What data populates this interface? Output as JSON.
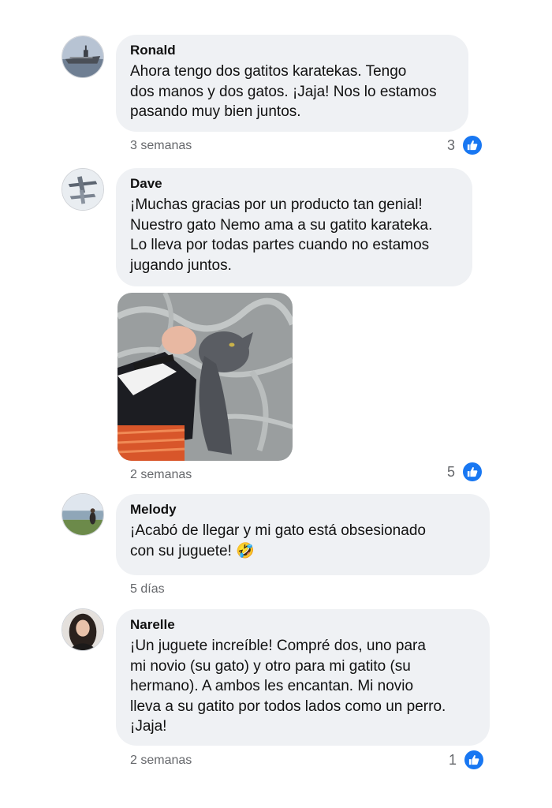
{
  "comments": [
    {
      "author": "Ronald",
      "avatar_icon": "aircraft-carrier-avatar",
      "text": "Ahora tengo dos gatitos karatekas. Tengo\ndos manos y dos gatos. ¡Jaja! Nos lo estamos\npasando muy bien juntos.",
      "time": "3 semanas",
      "likes": "3"
    },
    {
      "author": "Dave",
      "avatar_icon": "airplane-avatar",
      "text": "¡Muchas gracias por un producto tan genial!\nNuestro gato Nemo ama a su gatito karateka.\nLo lleva por todas partes cuando no estamos\njugando juntos.",
      "time": "2 semanas",
      "likes": "5",
      "photo_icon": "cat-with-karate-toy-photo"
    },
    {
      "author": "Melody",
      "avatar_icon": "lakeside-person-avatar",
      "text": "¡Acabó de llegar y mi gato está obsesionado\ncon su juguete! 🤣",
      "time": "5 días"
    },
    {
      "author": "Narelle",
      "avatar_icon": "woman-portrait-avatar",
      "text": "¡Un juguete increíble! Compré dos, uno para\nmi novio (su gato) y otro para mi gatito (su\nhermano). A ambos les encantan. Mi novio\nlleva a su gatito por todos lados como un perro.\n¡Jaja!",
      "time": "2 semanas",
      "likes": "1"
    }
  ],
  "colors": {
    "bubble": "#eff1f4",
    "like_blue": "#1877f2",
    "meta_gray": "#65676b",
    "text": "#111111"
  }
}
